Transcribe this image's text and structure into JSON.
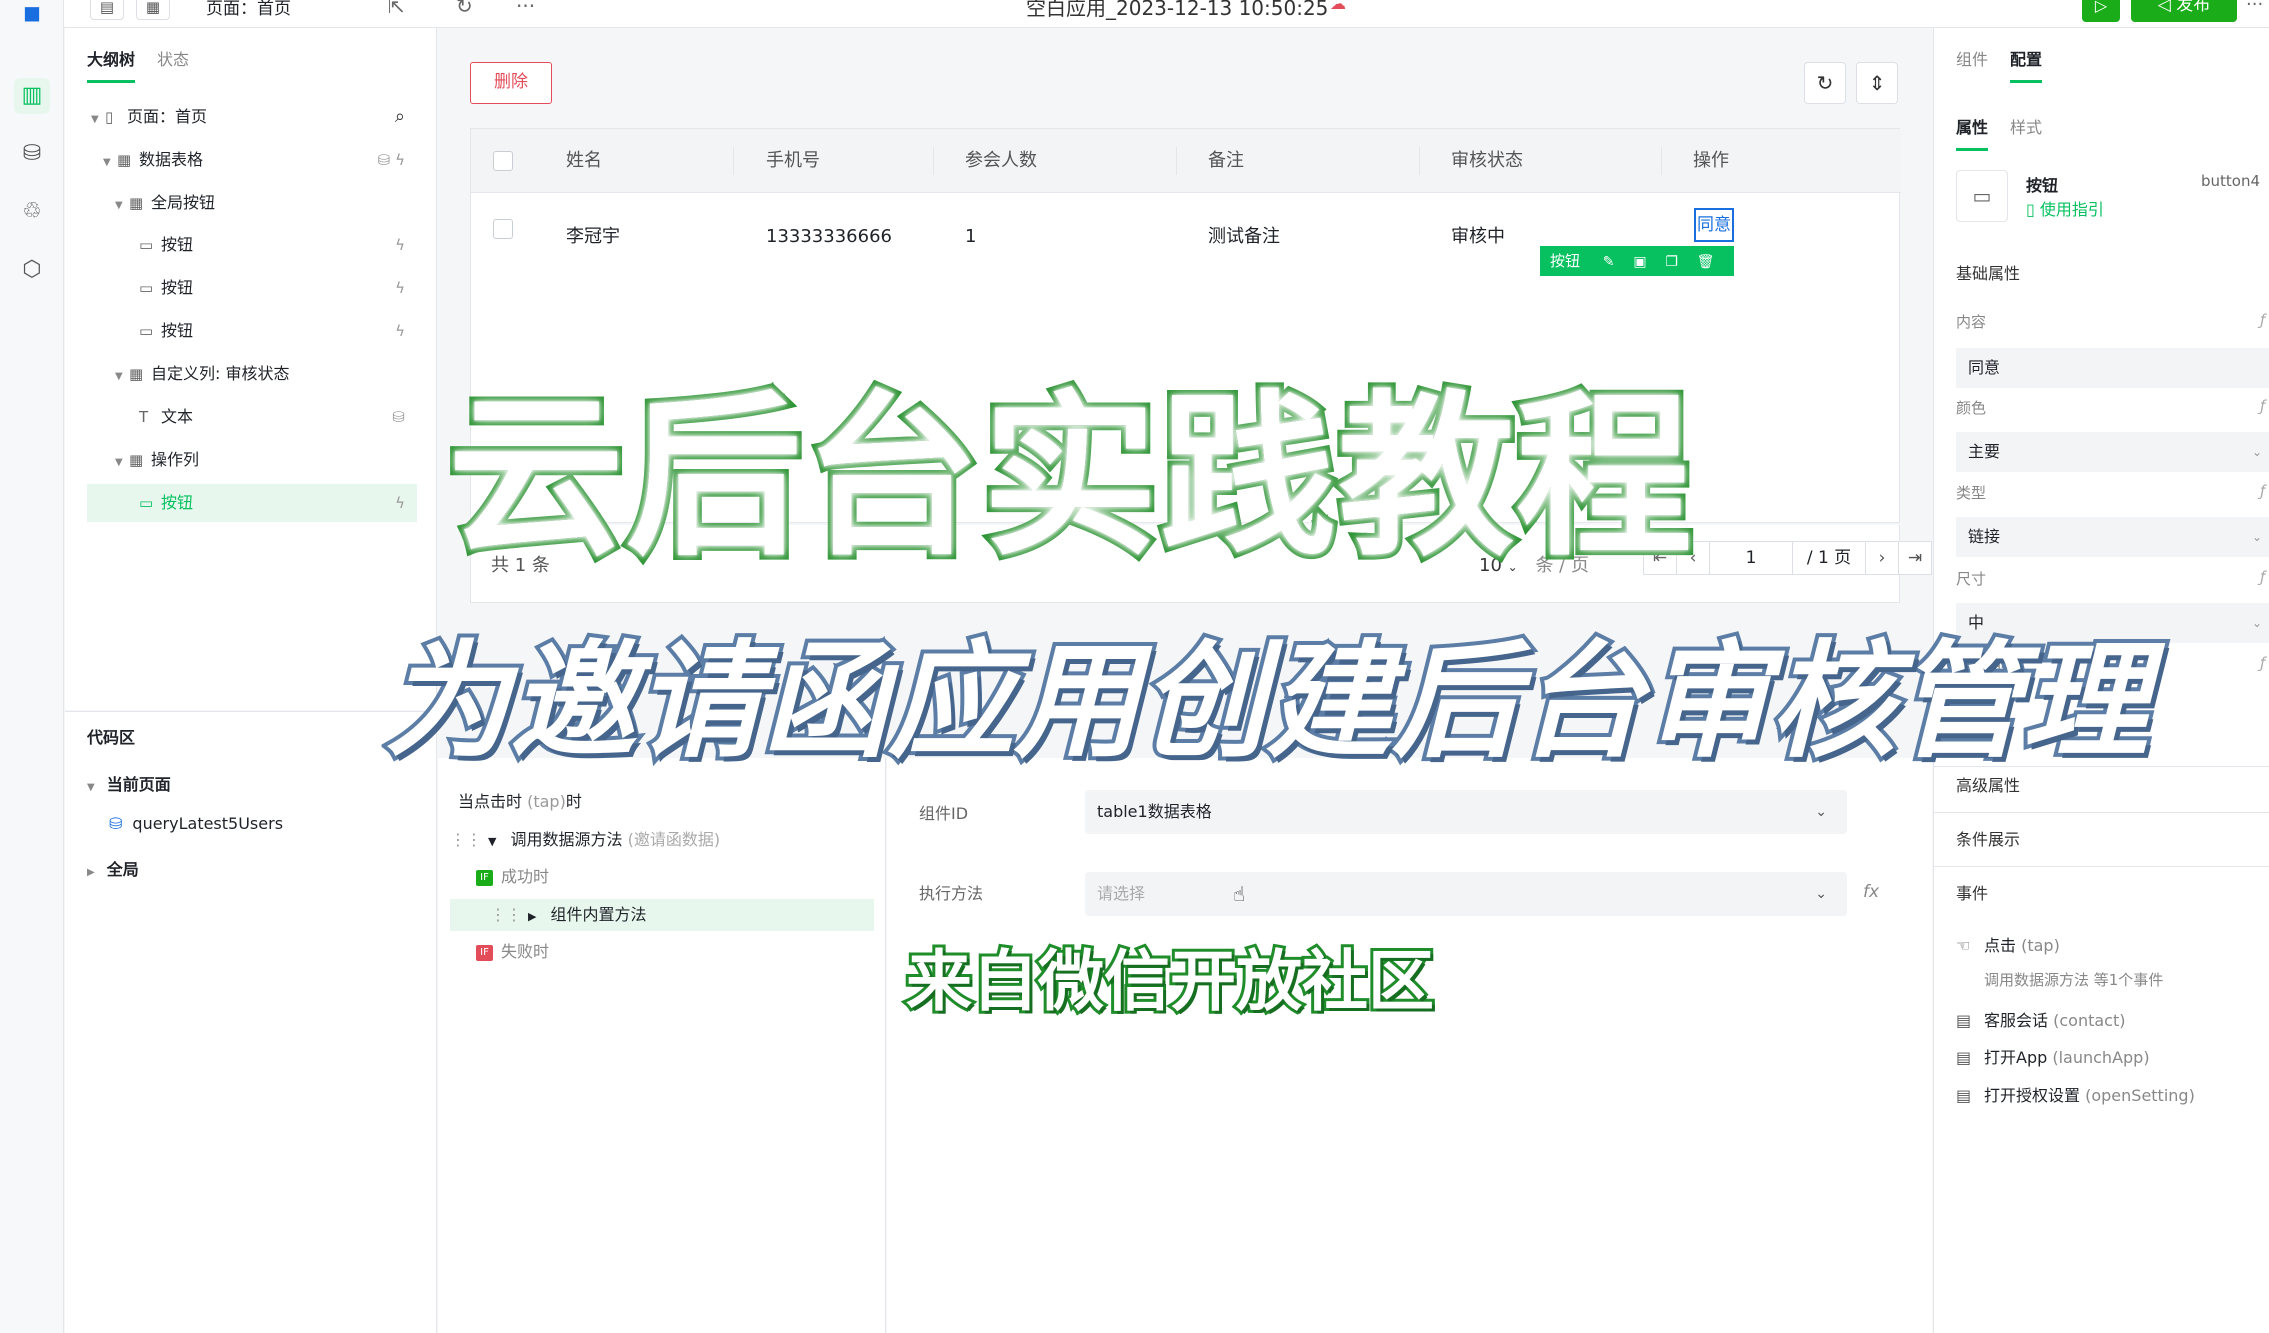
{
  "topbar": {
    "page_select": "页面：首页",
    "doc_title": "空白应用_2023-12-13 10:50:25",
    "publish_label": "发布",
    "more": "···"
  },
  "outline": {
    "tabs": [
      "大纲树",
      "状态"
    ],
    "items": [
      {
        "label": "页面：首页"
      },
      {
        "label": "数据表格"
      },
      {
        "label": "全局按钮"
      },
      {
        "label": "按钮"
      },
      {
        "label": "按钮"
      },
      {
        "label": "按钮"
      },
      {
        "label": "自定义列: 审核状态"
      },
      {
        "label": "文本"
      },
      {
        "label": "操作列"
      },
      {
        "label": "按钮"
      }
    ]
  },
  "codearea": {
    "title": "代码区",
    "current_page": "当前页面",
    "query": "queryLatest5Users",
    "global": "全局"
  },
  "canvas": {
    "delete_label": "删除",
    "table": {
      "headers": [
        "姓名",
        "手机号",
        "参会人数",
        "备注",
        "审核状态",
        "操作"
      ],
      "row": {
        "name": "李冠宇",
        "phone": "13333336666",
        "count": "1",
        "note": "测试备注",
        "status": "审核中",
        "action": "同意"
      }
    },
    "btn_tag_label": "按钮",
    "pager": {
      "total": "共 1 条",
      "page_size": "10",
      "page_unit": "条 / 页",
      "current": "1",
      "pages": "/ 1 页"
    }
  },
  "events": {
    "trigger": "当点击时",
    "trigger_code": "(tap)",
    "trigger_suffix": "时",
    "call": "调用数据源方法",
    "call_hint": "(邀请函数据)",
    "success": "成功时",
    "inner": "组件内置方法",
    "fail": "失败时"
  },
  "detail": {
    "comp_id_label": "组件ID",
    "comp_id_value": "table1数据表格",
    "method_label": "执行方法",
    "method_placeholder": "请选择",
    "fx": "fx"
  },
  "rpanel": {
    "tabs": [
      "组件",
      "配置"
    ],
    "subtabs": [
      "属性",
      "样式"
    ],
    "comp_name": "按钮",
    "comp_guide": "使用指引",
    "comp_id": "button4",
    "basic_title": "基础属性",
    "props": [
      {
        "label": "内容",
        "value": "同意"
      },
      {
        "label": "颜色",
        "value": "主要"
      },
      {
        "label": "类型",
        "value": "链接"
      },
      {
        "label": "尺寸",
        "value": "中"
      }
    ],
    "fullwidth_label": "是否通栏",
    "advanced": "高级属性",
    "conditional": "条件展示",
    "events_title": "事件",
    "event_list": [
      {
        "name": "点击",
        "code": "(tap)"
      },
      {
        "name": "客服会话",
        "code": "(contact)"
      },
      {
        "name": "打开App",
        "code": "(launchApp)"
      },
      {
        "name": "打开授权设置",
        "code": "(openSetting)"
      }
    ],
    "tap_sub": "调用数据源方法 等1个事件"
  },
  "captions": {
    "main": "云后台实践教程",
    "sub": "为邀请函应用创建后台审核管理",
    "source": "来自微信开放社区"
  },
  "colors": {
    "accent": "#07c160",
    "danger": "#e34d59",
    "link": "#1a6fe0"
  }
}
